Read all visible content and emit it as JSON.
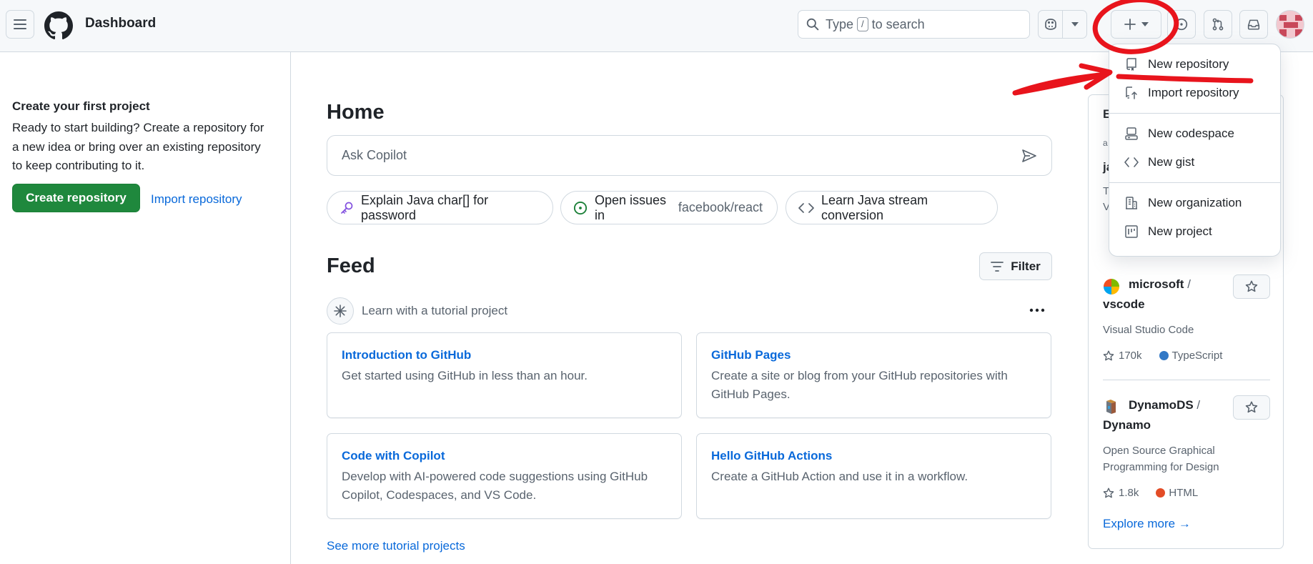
{
  "header": {
    "title": "Dashboard",
    "search": {
      "prefix": "Type",
      "key": "/",
      "suffix": "to search"
    },
    "avatar": "user-avatar"
  },
  "sidebar": {
    "title": "Create your first project",
    "description": "Ready to start building? Create a repository for a new idea or bring over an existing repository to keep contributing to it.",
    "create_button": "Create repository",
    "import_link": "Import repository"
  },
  "main": {
    "home_title": "Home",
    "ask_placeholder": "Ask Copilot",
    "chips": [
      {
        "text": "Explain Java char[] for password",
        "muted": ""
      },
      {
        "text": "Open issues in",
        "muted": "facebook/react"
      },
      {
        "text": "Learn Java stream conversion",
        "muted": ""
      }
    ],
    "feed_title": "Feed",
    "filter_label": "Filter",
    "tutorial_label": "Learn with a tutorial project",
    "cards": [
      {
        "title": "Introduction to GitHub",
        "desc": "Get started using GitHub in less than an hour."
      },
      {
        "title": "GitHub Pages",
        "desc": "Create a site or blog from your GitHub repositories with GitHub Pages."
      },
      {
        "title": "Code with Copilot",
        "desc": "Develop with AI-powered code suggestions using GitHub Copilot, Codespaces, and VS Code."
      },
      {
        "title": "Hello GitHub Actions",
        "desc": "Create a GitHub Action and use it in a workflow."
      }
    ],
    "see_more": "See more tutorial projects"
  },
  "explore": {
    "peek": [
      "E",
      "a",
      "ja",
      "T",
      "V"
    ],
    "repos": [
      {
        "owner": "microsoft",
        "slash": "/",
        "name": "vscode",
        "desc": "Visual Studio Code",
        "stars": "170k",
        "language": "TypeScript",
        "lang_color": "#3178c6"
      },
      {
        "owner": "DynamoDS",
        "slash": "/",
        "name": "Dynamo",
        "desc": "Open Source Graphical Programming for Design",
        "stars": "1.8k",
        "language": "HTML",
        "lang_color": "#e34c26"
      }
    ],
    "more": "Explore more →"
  },
  "dropdown": {
    "items": [
      {
        "label": "New repository",
        "icon": "repo-icon"
      },
      {
        "label": "Import repository",
        "icon": "repo-push-icon"
      },
      {
        "label": "New codespace",
        "icon": "codespace-icon"
      },
      {
        "label": "New gist",
        "icon": "code-icon"
      },
      {
        "label": "New organization",
        "icon": "organization-icon"
      },
      {
        "label": "New project",
        "icon": "project-icon"
      }
    ]
  },
  "colors": {
    "primary_green": "#1f883d",
    "link_blue": "#0969da",
    "annotation_red": "#e8141c"
  }
}
